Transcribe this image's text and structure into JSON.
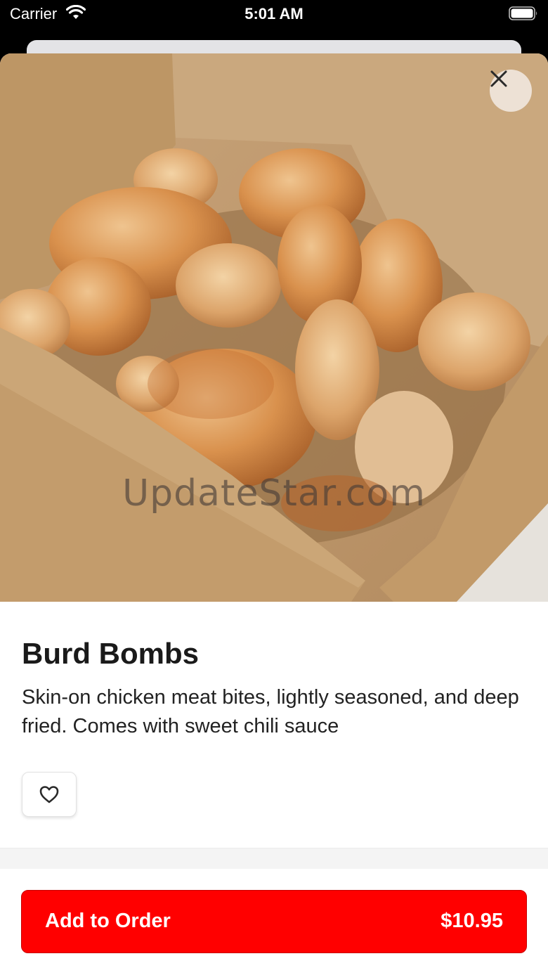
{
  "status_bar": {
    "carrier": "Carrier",
    "time": "5:01 AM"
  },
  "item": {
    "image_watermark": "UpdateStar.com",
    "title": "Burd Bombs",
    "description": "Skin-on chicken meat bites, lightly seasoned, and deep fried. Comes with sweet chili sauce"
  },
  "actions": {
    "add_to_order_label": "Add to Order",
    "price": "$10.95"
  },
  "icons": {
    "close": "close-icon",
    "favorite": "heart-outline-icon",
    "wifi": "wifi-icon",
    "battery": "battery-icon"
  },
  "colors": {
    "accent": "#ff0000",
    "text": "#1a1a1a"
  }
}
